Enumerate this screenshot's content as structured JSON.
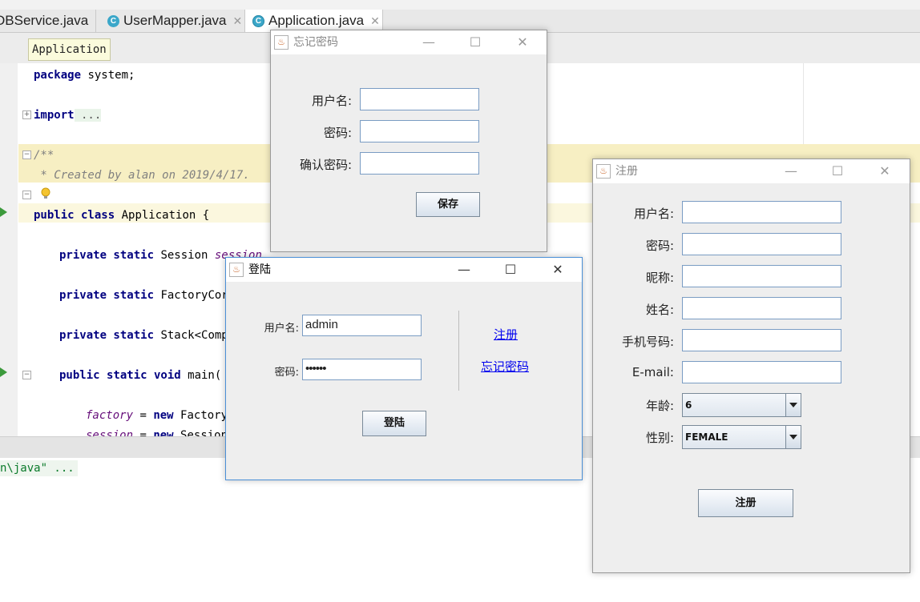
{
  "ide": {
    "tabs": [
      {
        "label": "DBService.java",
        "close": "✕"
      },
      {
        "label": "UserMapper.java",
        "close": "✕"
      },
      {
        "label": "Application.java",
        "close": "✕"
      }
    ],
    "breadcrumb_tooltip": "Application",
    "code": {
      "l1_kw": "package",
      "l1_rest": " system;",
      "l2_kw": "import",
      "l2_rest": " ...",
      "l3": "/**",
      "l4": " * Created by alan on 2019/4/17.",
      "l5_kw": "public class",
      "l5_rest": " Application {",
      "l6_kw": "private static",
      "l6_type": " Session ",
      "l6_field": "session",
      "l7_kw": "private static",
      "l7_type": " FactoryCor",
      "l8_kw": "private static",
      "l8_type": " Stack<Comp",
      "l9_kw": "public static void",
      "l9_rest": " main(",
      "l10_field": "factory",
      "l10_op": " = ",
      "l10_kw": "new",
      "l10_rest": " FactoryC",
      "l11_field": "session",
      "l11_op": " = ",
      "l11_kw": "new",
      "l11_rest": " Session("
    },
    "console_text": "n\\java\" ..."
  },
  "forgot_window": {
    "title": "忘记密码",
    "username_label": "用户名:",
    "password_label": "密码:",
    "confirm_label": "确认密码:",
    "save_button": "保存",
    "minimize": "—",
    "maximize": "☐",
    "close": "✕"
  },
  "login_window": {
    "title": "登陆",
    "username_label": "用户名:",
    "username_value": "admin",
    "password_label": "密码:",
    "password_value": "••••••",
    "register_link": "注册",
    "forgot_link": "忘记密码",
    "login_button": "登陆",
    "minimize": "—",
    "maximize": "☐",
    "close": "✕"
  },
  "register_window": {
    "title": "注册",
    "username_label": "用户名:",
    "password_label": "密码:",
    "nickname_label": "昵称:",
    "name_label": "姓名:",
    "phone_label": "手机号码:",
    "email_label": "E-mail:",
    "age_label": "年龄:",
    "age_value": "6",
    "gender_label": "性别:",
    "gender_value": "FEMALE",
    "register_button": "注册",
    "minimize": "—",
    "maximize": "☐",
    "close": "✕"
  }
}
